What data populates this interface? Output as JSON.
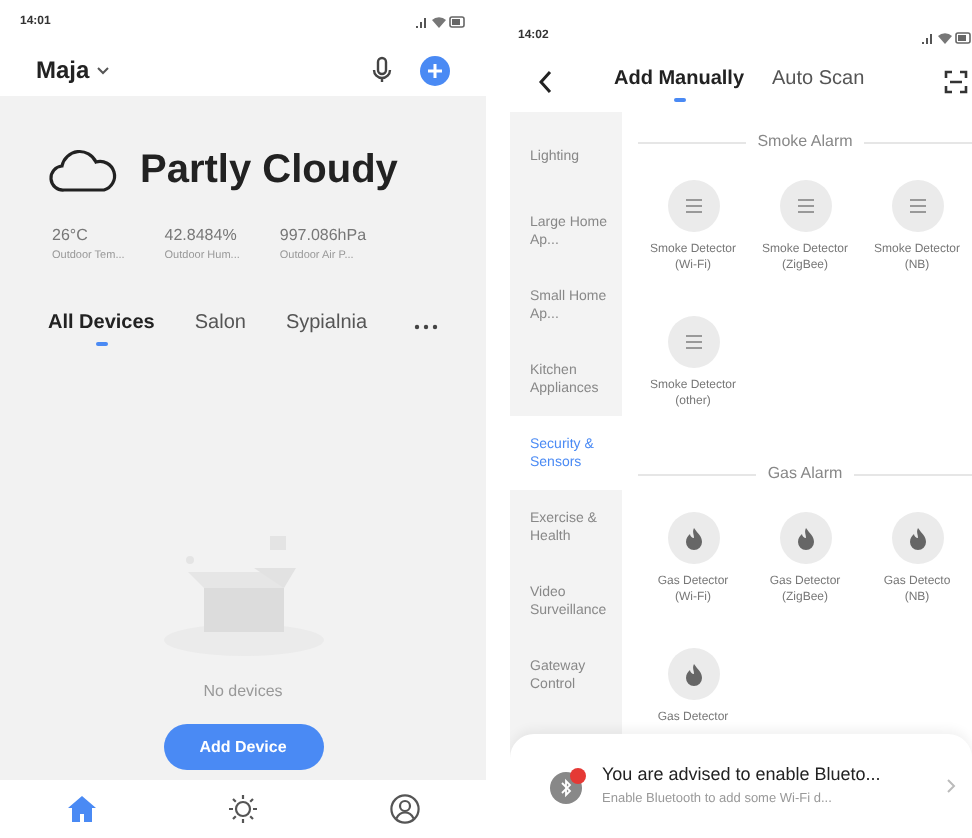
{
  "home_screen": {
    "status_time": "14:01",
    "home_name": "Maja",
    "weather": {
      "condition": "Partly Cloudy",
      "stats": [
        {
          "value": "26°C",
          "label": "Outdoor Tem..."
        },
        {
          "value": "42.8484%",
          "label": "Outdoor Hum..."
        },
        {
          "value": "997.086hPa",
          "label": "Outdoor Air P..."
        }
      ]
    },
    "rooms": [
      {
        "label": "All Devices",
        "selected": true
      },
      {
        "label": "Salon",
        "selected": false
      },
      {
        "label": "Sypialnia",
        "selected": false
      }
    ],
    "empty_message": "No devices",
    "add_button": "Add Device",
    "bottom_nav": [
      {
        "kind": "home",
        "selected": true
      },
      {
        "kind": "smart",
        "selected": false
      },
      {
        "kind": "me",
        "selected": false
      }
    ]
  },
  "add_device_screen": {
    "status_time": "14:02",
    "tabs": [
      {
        "label": "Add Manually",
        "selected": true
      },
      {
        "label": "Auto Scan",
        "selected": false
      }
    ],
    "categories": [
      {
        "label": "Lighting",
        "selected": false
      },
      {
        "label": "Large Home Ap...",
        "selected": false
      },
      {
        "label": "Small Home Ap...",
        "selected": false
      },
      {
        "label": "Kitchen Appliances",
        "selected": false
      },
      {
        "label": "Security & Sensors",
        "selected": true
      },
      {
        "label": "Exercise & Health",
        "selected": false
      },
      {
        "label": "Video Surveillance",
        "selected": false
      },
      {
        "label": "Gateway Control",
        "selected": false
      }
    ],
    "sections": [
      {
        "title": "Smoke Alarm",
        "kind": "smoke",
        "devices": [
          {
            "label": "Smoke Detector (Wi-Fi)"
          },
          {
            "label": "Smoke Detector (ZigBee)"
          },
          {
            "label": "Smoke Detector (NB)"
          },
          {
            "label": "Smoke Detector (other)"
          }
        ]
      },
      {
        "title": "Gas Alarm",
        "kind": "gas",
        "devices": [
          {
            "label": "Gas Detector (Wi-Fi)"
          },
          {
            "label": "Gas Detector (ZigBee)"
          },
          {
            "label": "Gas Detecto (NB)"
          },
          {
            "label": "Gas Detector"
          }
        ]
      }
    ],
    "banner": {
      "title": "You are advised to enable Blueto...",
      "subtitle": "Enable Bluetooth to add some Wi-Fi d..."
    }
  }
}
